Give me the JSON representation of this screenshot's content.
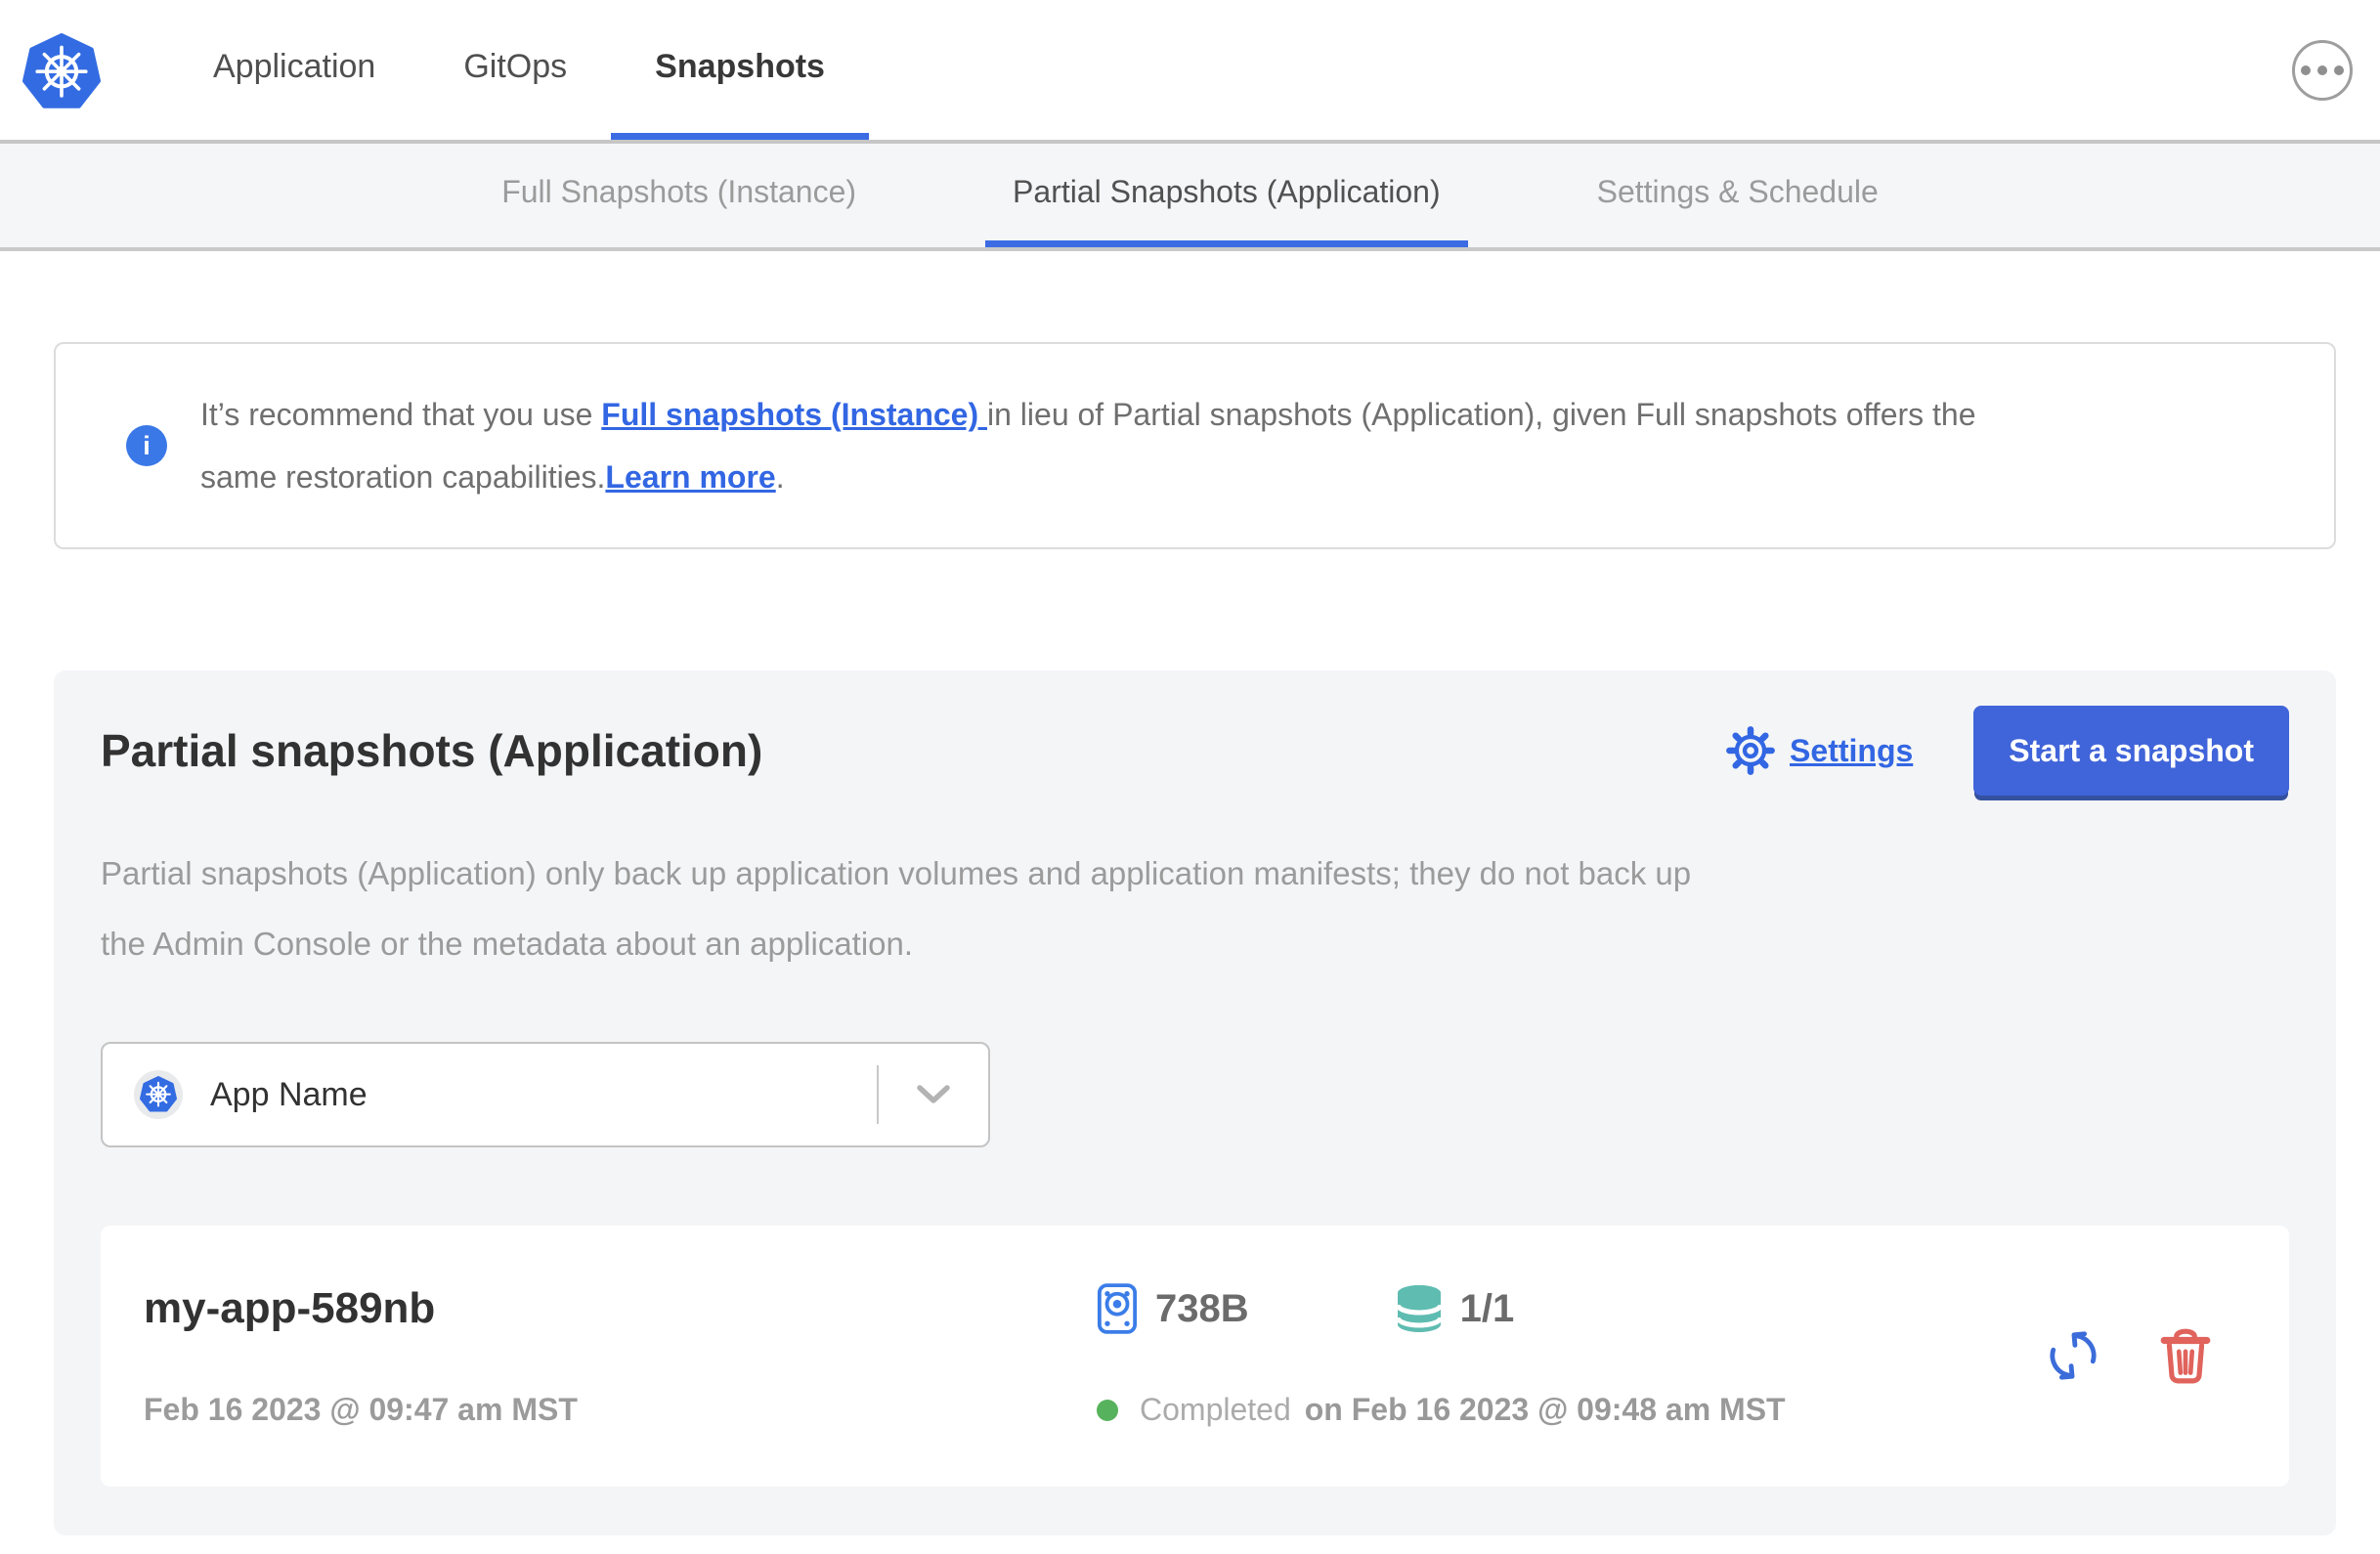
{
  "header": {
    "logo": "kubernetes-wheel-logo",
    "nav": [
      {
        "label": "Application",
        "active": false
      },
      {
        "label": "GitOps",
        "active": false
      },
      {
        "label": "Snapshots",
        "active": true
      }
    ],
    "menu_button": "ellipsis-menu"
  },
  "subnav": {
    "tabs": [
      {
        "label": "Full Snapshots (Instance)",
        "active": false
      },
      {
        "label": "Partial Snapshots (Application)",
        "active": true
      },
      {
        "label": "Settings & Schedule",
        "active": false
      }
    ]
  },
  "banner": {
    "icon": "info-icon",
    "info_glyph": "i",
    "line1_pre": "It’s recommend that you use ",
    "line1_link": "Full snapshots (Instance) ",
    "line1_post": "in lieu of Partial snapshots (Application), given Full snapshots offers the",
    "line2_pre": "same restoration capabilities.",
    "line2_link": "Learn more",
    "line2_post": "."
  },
  "panel": {
    "title": "Partial snapshots (Application)",
    "settings_label": "Settings",
    "start_button_label": "Start a snapshot",
    "description_line1": "Partial snapshots (Application) only back up application volumes and application manifests; they do not back up",
    "description_line2": "the Admin Console or the metadata about an application.",
    "app_selector": {
      "value": "App Name",
      "icon": "kubernetes-app-icon",
      "caret": "chevron-down-icon"
    },
    "snapshot": {
      "name": "my-app-589nb",
      "created": "Feb 16 2023 @ 09:47 am MST",
      "size": "738B",
      "size_icon": "volume-disk-icon",
      "volumes": "1/1",
      "volumes_icon": "database-icon",
      "status": "Completed",
      "status_detail": "on Feb 16 2023 @ 09:48 am MST",
      "actions": [
        "restore-icon",
        "delete-icon"
      ]
    }
  },
  "colors": {
    "primary_blue": "#3c6ce4",
    "button_blue": "#4064d9",
    "link_blue": "#3266e3",
    "teal": "#5fbcb1",
    "delete_red": "#e0635c",
    "status_green": "#56b25c",
    "muted_gray": "#9b9b9b",
    "panel_gray": "#f4f5f7"
  }
}
